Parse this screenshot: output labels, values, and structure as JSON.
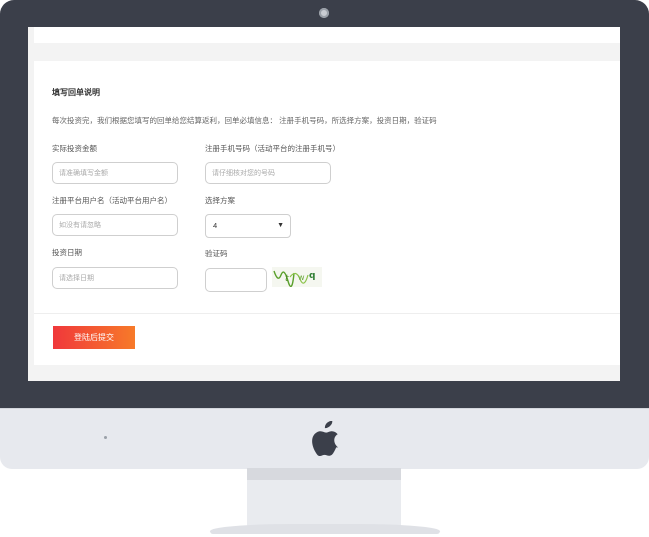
{
  "form": {
    "section_title": "填写回单说明",
    "description": "每次投资完，我们根据您填写的回单给您结算返利，回单必填信息： 注册手机号码，所选择方案，投资日期，验证码",
    "fields": {
      "amount": {
        "label": "实际投资金额",
        "placeholder": "请准确填写金额"
      },
      "phone": {
        "label": "注册手机号码（活动平台的注册手机号）",
        "placeholder": "请仔细核对您的号码"
      },
      "username": {
        "label": "注册平台用户名（活动平台用户名）",
        "placeholder": "如没有请忽略"
      },
      "plan": {
        "label": "选择方案",
        "selected": "4"
      },
      "date": {
        "label": "投资日期",
        "placeholder": "请选择日期"
      },
      "captcha": {
        "label": "验证码",
        "value": ""
      }
    },
    "submit_label": "登陆后提交"
  },
  "icons": {
    "apple": "apple-logo-icon",
    "camera": "camera-icon",
    "captcha": "captcha-image",
    "dropdown": "chevron-down-icon"
  },
  "colors": {
    "bezel": "#3b3f4a",
    "button_start": "#f0383b",
    "button_end": "#f77a29"
  }
}
